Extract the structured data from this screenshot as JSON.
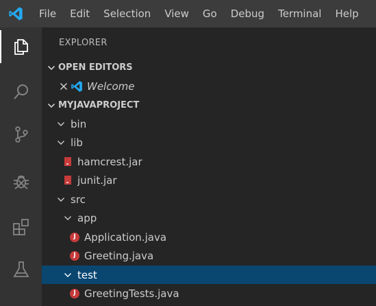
{
  "menu": [
    "File",
    "Edit",
    "Selection",
    "View",
    "Go",
    "Debug",
    "Terminal",
    "Help"
  ],
  "activity_bar": [
    {
      "icon": "files-icon",
      "active": true
    },
    {
      "icon": "search-icon",
      "active": false
    },
    {
      "icon": "source-control-icon",
      "active": false
    },
    {
      "icon": "debug-icon",
      "active": false
    },
    {
      "icon": "extensions-icon",
      "active": false
    },
    {
      "icon": "test-flask-icon",
      "active": false
    }
  ],
  "explorer": {
    "title": "EXPLORER",
    "open_editors": {
      "header": "OPEN EDITORS",
      "items": [
        {
          "label": "Welcome",
          "icon": "vscode-icon"
        }
      ]
    },
    "project": {
      "header": "MYJAVAPROJECT",
      "tree": [
        {
          "label": "bin",
          "type": "folder"
        },
        {
          "label": "lib",
          "type": "folder"
        },
        {
          "label": "hamcrest.jar",
          "type": "jar"
        },
        {
          "label": "junit.jar",
          "type": "jar"
        },
        {
          "label": "src",
          "type": "folder"
        },
        {
          "label": "app",
          "type": "folder"
        },
        {
          "label": "Application.java",
          "type": "java"
        },
        {
          "label": "Greeting.java",
          "type": "java"
        },
        {
          "label": "test",
          "type": "folder",
          "selected": true
        },
        {
          "label": "GreetingTests.java",
          "type": "java"
        }
      ]
    }
  },
  "colors": {
    "titlebar": "#3c3c3c",
    "activitybar": "#333333",
    "sidebar": "#252526",
    "selection": "#094771",
    "vscode_blue": "#23a9f2",
    "java_red": "#c73b3b"
  }
}
